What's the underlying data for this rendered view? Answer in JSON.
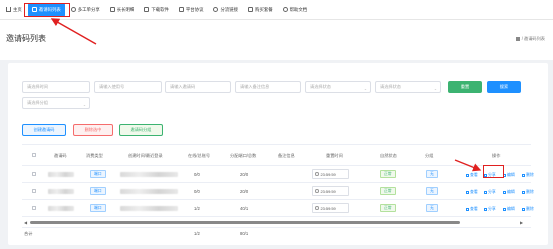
{
  "nav": {
    "items": [
      {
        "label": "主页",
        "icon": "home-icon"
      },
      {
        "label": "邀请码列表",
        "icon": "qrcode-icon",
        "active": true
      },
      {
        "label": "多工单分享",
        "icon": "share-icon"
      },
      {
        "label": "长长明细",
        "icon": "list-icon"
      },
      {
        "label": "下载软件",
        "icon": "download-icon"
      },
      {
        "label": "平台协议",
        "icon": "document-icon"
      },
      {
        "label": "分流链接",
        "icon": "link-icon"
      },
      {
        "label": "购买套餐",
        "icon": "cart-icon"
      },
      {
        "label": "帮助文档",
        "icon": "help-icon"
      }
    ]
  },
  "page": {
    "title": "邀请码列表",
    "breadcrumb": "/ 邀请码列表"
  },
  "filters": {
    "placeholders": [
      "请选择时间",
      "请输入使用号",
      "请输入邀请码",
      "请输入备注信息",
      "请选择状态",
      "请选择状态",
      "请选择分组"
    ],
    "reset_label": "重置",
    "search_label": "搜索"
  },
  "actions": {
    "create_label": "创建邀请码",
    "delete_label": "删除选中",
    "group_label": "邀请码分组"
  },
  "table": {
    "headers": [
      "邀请码",
      "消费类型",
      "创建时间/最近登录",
      "在线/总账号",
      "分配端口/总数",
      "备注信息",
      "重置时间",
      "自然状态",
      "分组",
      "操作"
    ],
    "rows": [
      {
        "type": "端口",
        "online": "0/0",
        "ports": "20/0",
        "reset": "23:59:59",
        "status": "正常",
        "group": "无"
      },
      {
        "type": "端口",
        "online": "0/0",
        "ports": "20/0",
        "reset": "23:59:59",
        "status": "正常",
        "group": "无"
      },
      {
        "type": "端口",
        "online": "1/2",
        "ports": "40/1",
        "reset": "23:59:59",
        "status": "正常",
        "group": "无"
      }
    ],
    "row_actions": [
      "查看",
      "分享",
      "编辑",
      "删除"
    ],
    "summary": {
      "label": "合计",
      "online": "1/2",
      "ports": "80/1"
    }
  },
  "colors": {
    "accent": "#1e90ff",
    "success": "#3cb371",
    "danger": "#f56c6c",
    "highlight": "#e02020"
  }
}
